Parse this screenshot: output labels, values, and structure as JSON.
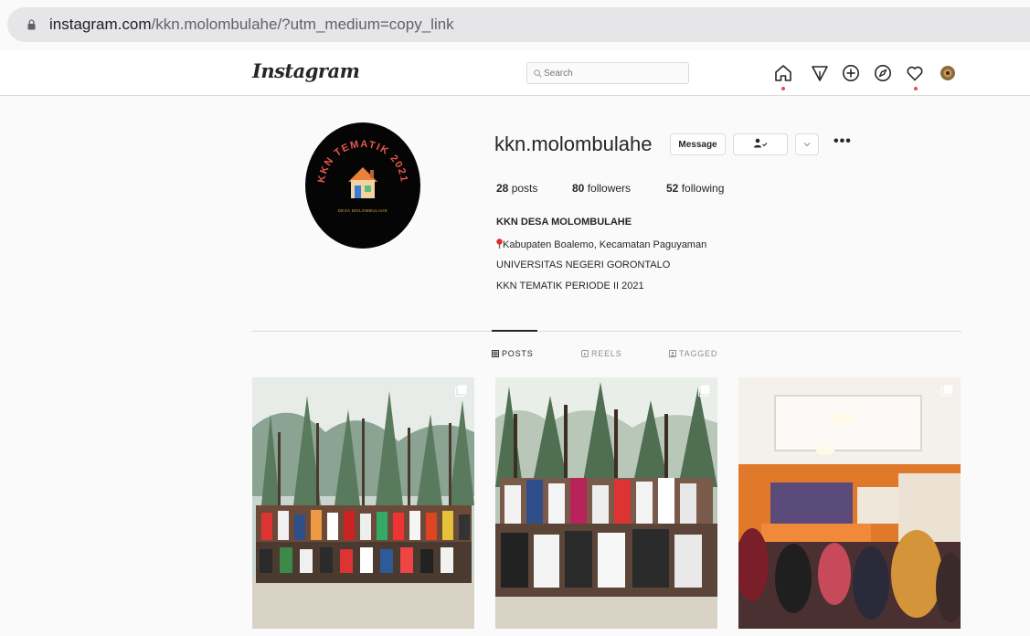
{
  "browser": {
    "url_host": "instagram.com",
    "url_path": "/kkn.molombulahe/?utm_medium=copy_link"
  },
  "nav": {
    "logo": "Instagram",
    "search_placeholder": "Search",
    "icons": [
      "home-icon",
      "direct-icon",
      "new-post-icon",
      "explore-icon",
      "activity-icon",
      "profile-icon"
    ]
  },
  "profile": {
    "username": "kkn.molombulahe",
    "message_label": "Message",
    "avatar_ring_text": "KKN TEMATIK 2021",
    "avatar_caption": "DESA MOLOMBULAHE",
    "stats": [
      {
        "count": "28",
        "label": "posts"
      },
      {
        "count": "80",
        "label": "followers"
      },
      {
        "count": "52",
        "label": "following"
      }
    ],
    "bio": {
      "name": "KKN DESA MOLOMBULAHE",
      "location": "Kabupaten Boalemo, Kecamatan Paguyaman",
      "line2": "UNIVERSITAS NEGERI GORONTALO",
      "line3": "KKN TEMATIK PERIODE II 2021"
    }
  },
  "tabs": [
    {
      "label": "POSTS",
      "active": true
    },
    {
      "label": "REELS",
      "active": false
    },
    {
      "label": "TAGGED",
      "active": false
    }
  ],
  "colors": {
    "notification_dot": "#ed4956",
    "house_orange": "#e8813a",
    "avatar_ring_text": "#e8564a"
  }
}
